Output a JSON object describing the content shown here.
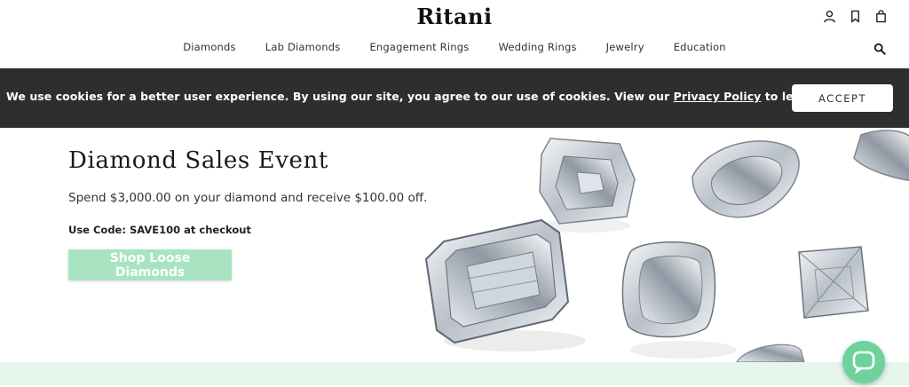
{
  "brand": {
    "logo": "Ritani"
  },
  "header": {
    "icons": [
      "account-icon",
      "bookmark-icon",
      "bag-icon"
    ],
    "nav": [
      {
        "label": "Diamonds"
      },
      {
        "label": "Lab Diamonds"
      },
      {
        "label": "Engagement Rings"
      },
      {
        "label": "Wedding Rings"
      },
      {
        "label": "Jewelry"
      },
      {
        "label": "Education"
      }
    ],
    "search_icon": "search-icon"
  },
  "cookie": {
    "text_before": "We use cookies for a better user experience. By using our site, you agree to our use of cookies. View our ",
    "link": "Privacy Policy",
    "text_after": " to learn more.",
    "accept": "ACCEPT"
  },
  "hero": {
    "title": "Diamond Sales Event",
    "subtitle": "Spend $3,000.00 on your diamond and receive $100.00 off.",
    "code": "Use Code: SAVE100 at checkout",
    "cta": "Shop Loose Diamonds"
  },
  "colors": {
    "cookie_bg": "#2e2e2e",
    "cta_bg": "#a8e4c2",
    "band_bg": "#e6f6ec",
    "chat_bg": "#6dd39b"
  },
  "chat": {
    "icon": "chat-bubble-icon"
  }
}
